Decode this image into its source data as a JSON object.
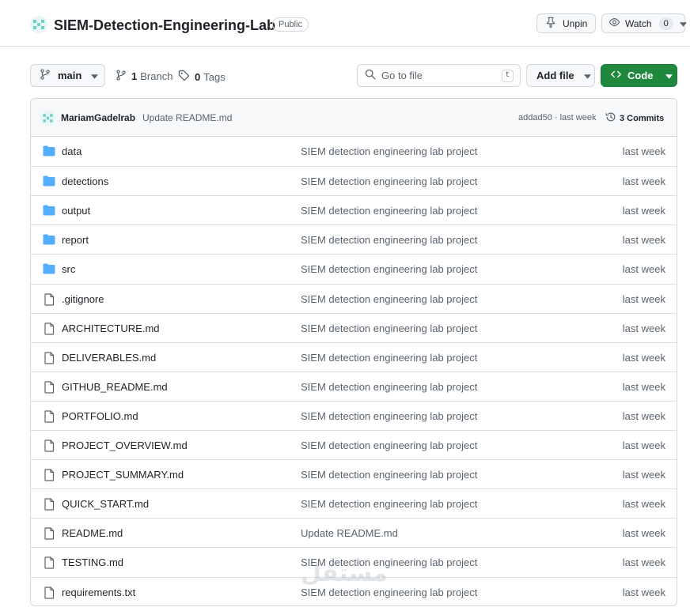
{
  "repo": {
    "name": "SIEM-Detection-Engineering-Lab",
    "visibility": "Public",
    "unpin_label": "Unpin",
    "watch_label": "Watch",
    "watch_count": "0"
  },
  "toolbar": {
    "branch": "main",
    "branch_count": "1",
    "branch_word": "Branch",
    "tag_count": "0",
    "tag_word": "Tags",
    "goto_placeholder": "Go to file",
    "goto_shortcut": "t",
    "add_file_label": "Add file",
    "code_label": "Code",
    "code_color": "#1f883d"
  },
  "latest_commit": {
    "author": "MariamGadelrab",
    "message": "Update README.md",
    "hash_and_time": "addad50 · last week",
    "commits_label": "3 Commits"
  },
  "files": [
    {
      "name": "data",
      "type": "folder",
      "message": "SIEM detection engineering lab project",
      "time": "last week"
    },
    {
      "name": "detections",
      "type": "folder",
      "message": "SIEM detection engineering lab project",
      "time": "last week"
    },
    {
      "name": "output",
      "type": "folder",
      "message": "SIEM detection engineering lab project",
      "time": "last week"
    },
    {
      "name": "report",
      "type": "folder",
      "message": "SIEM detection engineering lab project",
      "time": "last week"
    },
    {
      "name": "src",
      "type": "folder",
      "message": "SIEM detection engineering lab project",
      "time": "last week"
    },
    {
      "name": ".gitignore",
      "type": "file",
      "message": "SIEM detection engineering lab project",
      "time": "last week"
    },
    {
      "name": "ARCHITECTURE.md",
      "type": "file",
      "message": "SIEM detection engineering lab project",
      "time": "last week"
    },
    {
      "name": "DELIVERABLES.md",
      "type": "file",
      "message": "SIEM detection engineering lab project",
      "time": "last week"
    },
    {
      "name": "GITHUB_README.md",
      "type": "file",
      "message": "SIEM detection engineering lab project",
      "time": "last week"
    },
    {
      "name": "PORTFOLIO.md",
      "type": "file",
      "message": "SIEM detection engineering lab project",
      "time": "last week"
    },
    {
      "name": "PROJECT_OVERVIEW.md",
      "type": "file",
      "message": "SIEM detection engineering lab project",
      "time": "last week"
    },
    {
      "name": "PROJECT_SUMMARY.md",
      "type": "file",
      "message": "SIEM detection engineering lab project",
      "time": "last week"
    },
    {
      "name": "QUICK_START.md",
      "type": "file",
      "message": "SIEM detection engineering lab project",
      "time": "last week"
    },
    {
      "name": "README.md",
      "type": "file",
      "message": "Update README.md",
      "time": "last week"
    },
    {
      "name": "TESTING.md",
      "type": "file",
      "message": "SIEM detection engineering lab project",
      "time": "last week"
    },
    {
      "name": "requirements.txt",
      "type": "file",
      "message": "SIEM detection engineering lab project",
      "time": "last week"
    }
  ],
  "watermark_text": "مستقل",
  "colors": {
    "folder": "#54aeff",
    "file": "#59636e",
    "accent": "#1f883d"
  }
}
